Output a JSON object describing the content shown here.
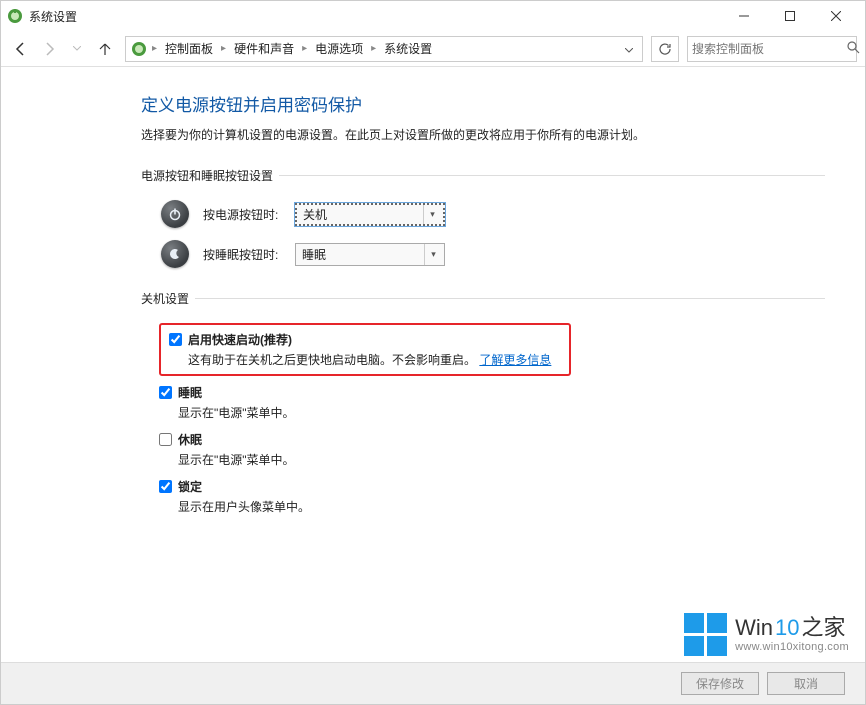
{
  "window": {
    "title": "系统设置"
  },
  "breadcrumb": {
    "items": [
      "控制面板",
      "硬件和声音",
      "电源选项",
      "系统设置"
    ]
  },
  "search": {
    "placeholder": "搜索控制面板"
  },
  "page": {
    "title": "定义电源按钮并启用密码保护",
    "desc": "选择要为你的计算机设置的电源设置。在此页上对设置所做的更改将应用于你所有的电源计划。"
  },
  "section1": {
    "heading": "电源按钮和睡眠按钮设置",
    "power_label": "按电源按钮时:",
    "power_value": "关机",
    "sleep_label": "按睡眠按钮时:",
    "sleep_value": "睡眠"
  },
  "section2": {
    "heading": "关机设置",
    "fast_startup": {
      "label": "启用快速启动(推荐)",
      "desc_pre": "这有助于在关机之后更快地启动电脑。不会影响重启。",
      "link": "了解更多信息",
      "checked": true
    },
    "sleep": {
      "label": "睡眠",
      "desc": "显示在\"电源\"菜单中。",
      "checked": true
    },
    "hibernate": {
      "label": "休眠",
      "desc": "显示在\"电源\"菜单中。",
      "checked": false
    },
    "lock": {
      "label": "锁定",
      "desc": "显示在用户头像菜单中。",
      "checked": true
    }
  },
  "buttons": {
    "save": "保存修改",
    "cancel": "取消"
  },
  "watermark": {
    "brand_a": "Win",
    "brand_b": "10",
    "brand_c": "之家",
    "url": "www.win10xitong.com"
  }
}
